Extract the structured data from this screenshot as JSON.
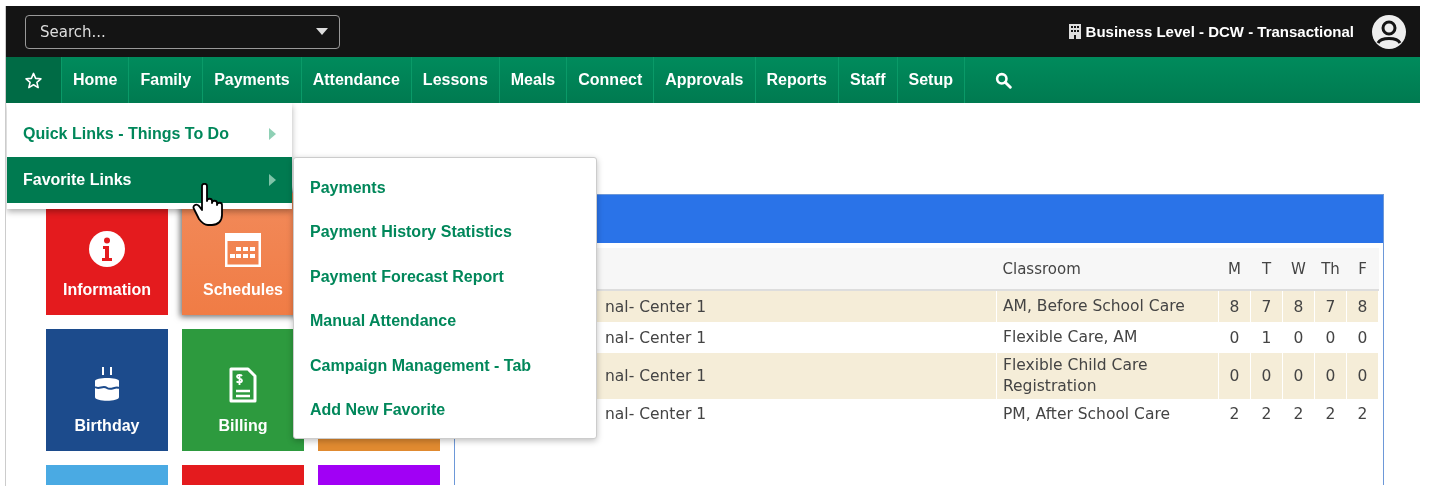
{
  "top_bar": {
    "search": {
      "placeholder": "Search..."
    },
    "business": "Business Level - DCW - Transactional"
  },
  "nav": {
    "favorites_open": true,
    "items": [
      "Home",
      "Family",
      "Payments",
      "Attendance",
      "Lessons",
      "Meals",
      "Connect",
      "Approvals",
      "Reports",
      "Staff",
      "Setup"
    ]
  },
  "favorites_menu": [
    {
      "label": "Quick Links - Things To Do",
      "selected": false
    },
    {
      "label": "Favorite Links",
      "selected": true
    }
  ],
  "favorite_links": [
    "Payments",
    "Payment History Statistics",
    "Payment Forecast Report",
    "Manual Attendance",
    "Campaign Management - Tab",
    "Add New Favorite"
  ],
  "tile_rows": [
    [
      {
        "kind": "info",
        "label": "Information",
        "color": "#e41b1e",
        "hovered": false
      },
      {
        "kind": "calendar",
        "label": "Schedules",
        "color": "#f28a5a",
        "hovered": true
      }
    ],
    [
      {
        "kind": "cake",
        "label": "Birthday",
        "color": "#1c4b8c",
        "hovered": false
      },
      {
        "kind": "bill",
        "label": "Billing",
        "color": "#2d9a3e",
        "hovered": false
      },
      {
        "kind": "plain",
        "color": "#e08a30",
        "hovered": false
      }
    ],
    [
      {
        "kind": "plain",
        "color": "#4aaae3",
        "hovered": false
      },
      {
        "kind": "plain",
        "color": "#e41b1e",
        "hovered": false
      },
      {
        "kind": "plain",
        "color": "#a100f5",
        "hovered": false
      }
    ]
  ],
  "table": {
    "columns": [
      "Classroom",
      "M",
      "T",
      "W",
      "Th",
      "F"
    ],
    "rows": [
      {
        "column_1": "nal- Center 1",
        "classroom": "AM, Before School Care",
        "days": [
          "8",
          "7",
          "8",
          "7",
          "8"
        ]
      },
      {
        "column_1": "nal- Center 1",
        "classroom": "Flexible Care, AM",
        "days": [
          "0",
          "1",
          "0",
          "0",
          "0"
        ]
      },
      {
        "column_1": "nal- Center 1",
        "classroom": "Flexible Child Care Registration",
        "days": [
          "0",
          "0",
          "0",
          "0",
          "0"
        ]
      },
      {
        "column_1": "nal- Center 1",
        "classroom": "PM, After School Care",
        "days": [
          "2",
          "2",
          "2",
          "2",
          "2"
        ]
      }
    ]
  }
}
